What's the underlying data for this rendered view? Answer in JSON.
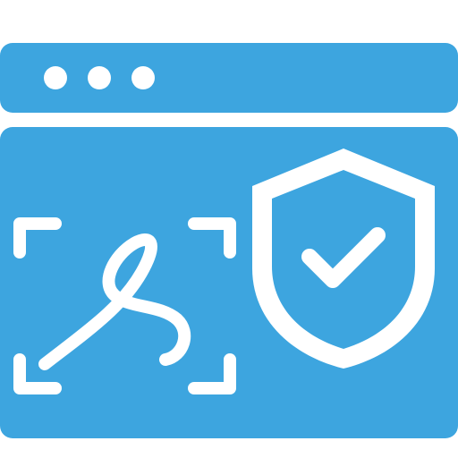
{
  "icon": {
    "name": "browser-signature-security-icon",
    "colors": {
      "primary": "#3DA5DF",
      "foreground": "#FFFFFF",
      "background": "#FFFFFF"
    },
    "parts": [
      "browser-window-icon",
      "window-dots-icon",
      "scan-frame-icon",
      "signature-scribble-icon",
      "shield-icon",
      "checkmark-icon"
    ]
  }
}
